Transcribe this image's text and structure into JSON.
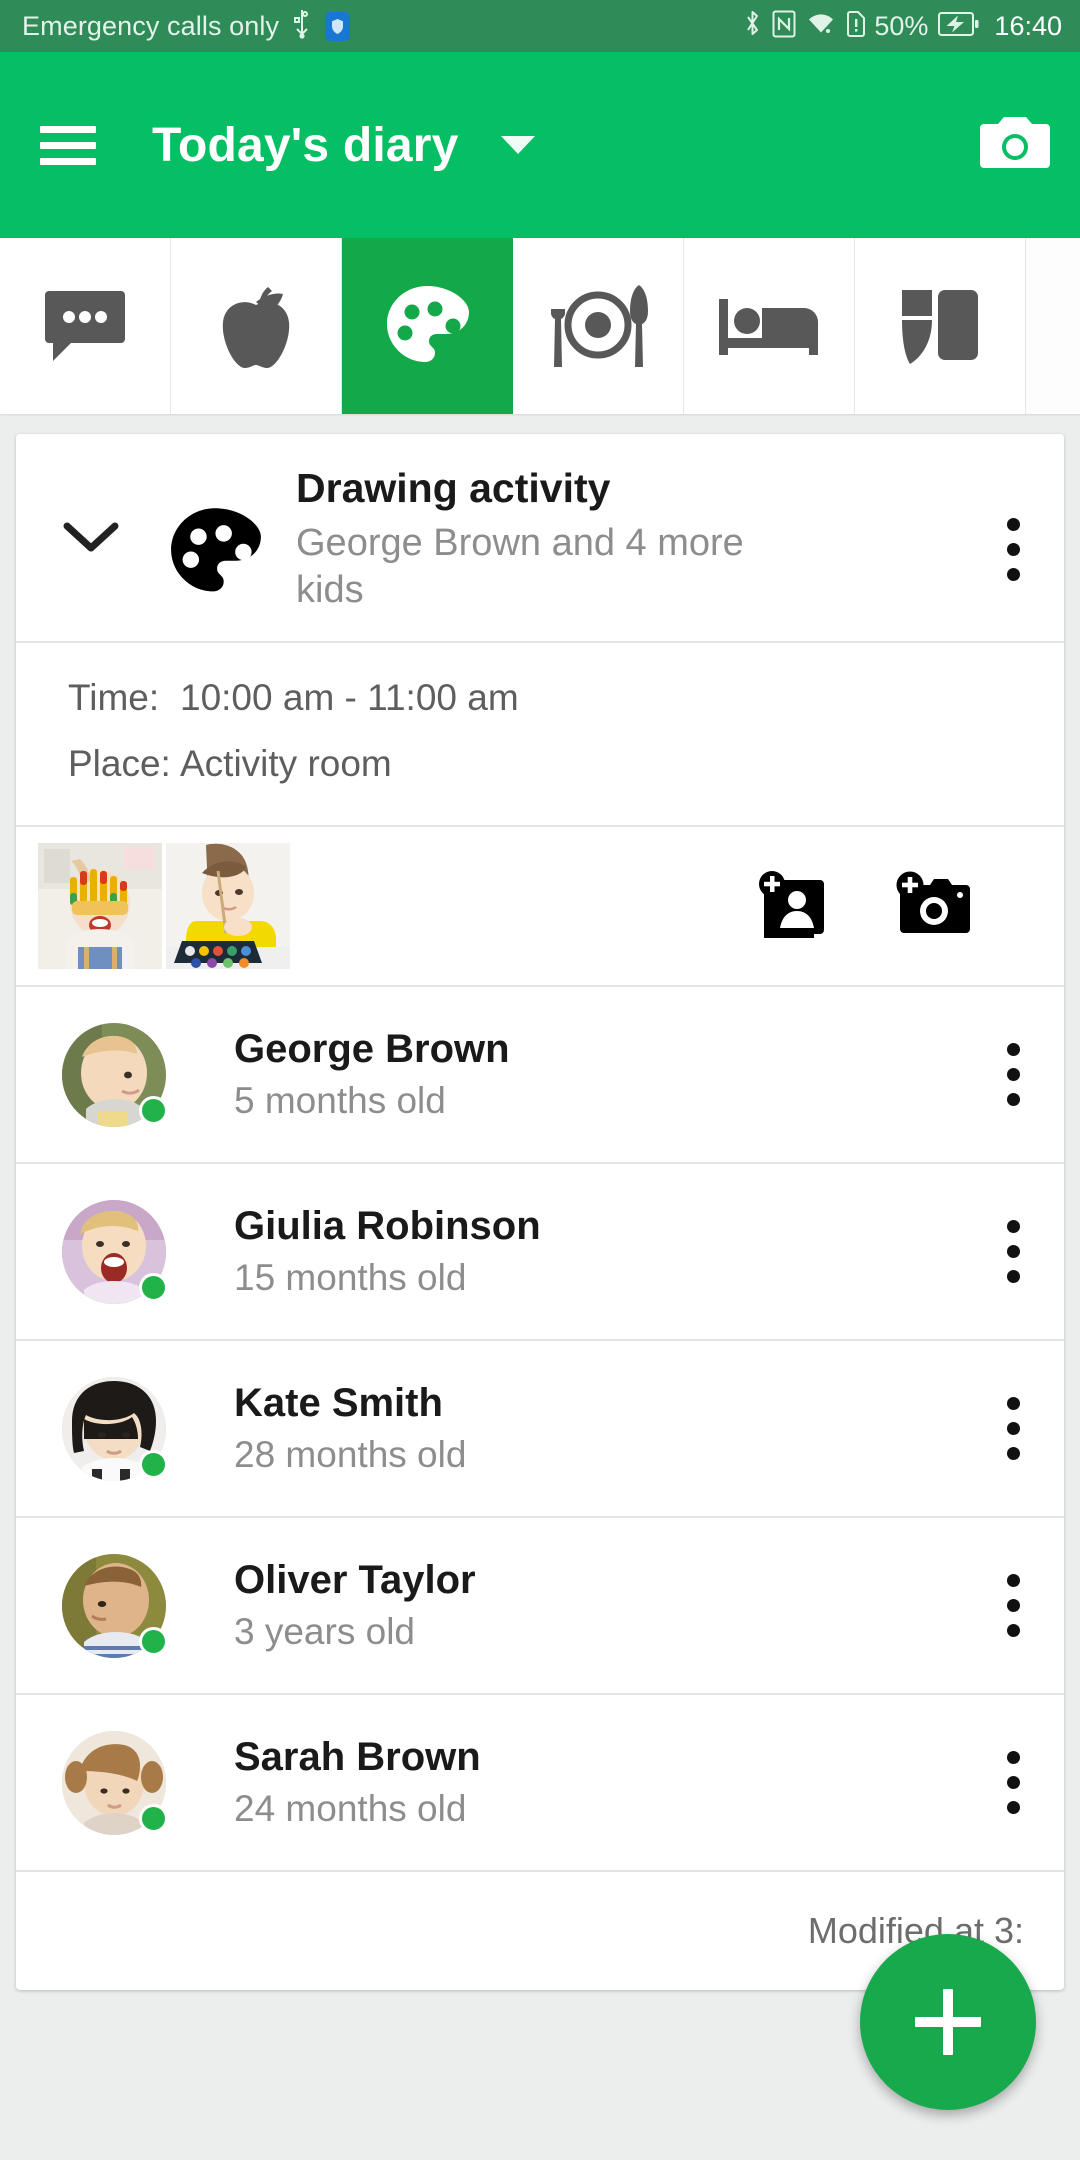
{
  "status_bar": {
    "carrier_text": "Emergency calls only",
    "icons_left": [
      "usb-icon",
      "shield-icon"
    ],
    "icons_right": [
      "bluetooth-icon",
      "nfc-icon",
      "wifi-icon",
      "sim-alert-icon"
    ],
    "battery_percent": "50%",
    "battery_state_icon": "battery-charging-icon",
    "clock": "16:40",
    "background_color": "#2f8b57"
  },
  "app_bar": {
    "menu_icon": "hamburger-menu-icon",
    "title": "Today's diary",
    "dropdown_icon": "caret-down-icon",
    "camera_icon": "camera-icon",
    "background_color": "#04bf63"
  },
  "tabs": [
    {
      "name": "notes",
      "icon": "chat-bubble-icon",
      "active": false
    },
    {
      "name": "food",
      "icon": "apple-icon",
      "active": false
    },
    {
      "name": "activities",
      "icon": "palette-icon",
      "active": true
    },
    {
      "name": "meals",
      "icon": "cutlery-plate-icon",
      "active": false
    },
    {
      "name": "sleep",
      "icon": "bed-icon",
      "active": false
    },
    {
      "name": "nappy",
      "icon": "nappy-icon",
      "active": false
    }
  ],
  "tab_active_color": "#13a949",
  "card": {
    "expand_icon": "chevron-down-icon",
    "activity_icon": "palette-icon",
    "title": "Drawing activity",
    "subtitle": "George Brown and 4 more kids",
    "overflow_icon": "more-vertical-icon",
    "details": [
      {
        "label": "Time:",
        "value": "10:00 am - 11:00 am"
      },
      {
        "label": "Place:",
        "value": "Activity room"
      }
    ],
    "photos": [
      {
        "name": "photo-child-painted-hands"
      },
      {
        "name": "photo-child-watercolours"
      }
    ],
    "photo_actions": [
      {
        "name": "add-photo-from-gallery",
        "icon": "add-image-icon"
      },
      {
        "name": "add-photo-from-camera",
        "icon": "add-camera-icon"
      }
    ],
    "children": [
      {
        "name": "George Brown",
        "age": "5 months old",
        "present": true
      },
      {
        "name": "Giulia Robinson",
        "age": "15 months old",
        "present": true
      },
      {
        "name": "Kate Smith",
        "age": "28 months old",
        "present": true
      },
      {
        "name": "Oliver Taylor",
        "age": "3 years old",
        "present": true
      },
      {
        "name": "Sarah Brown",
        "age": "24 months old",
        "present": true
      }
    ],
    "modified_text": "Modified at 3:",
    "presence_color": "#21b24a"
  },
  "fab": {
    "icon": "plus-icon",
    "color": "#17a94b"
  }
}
